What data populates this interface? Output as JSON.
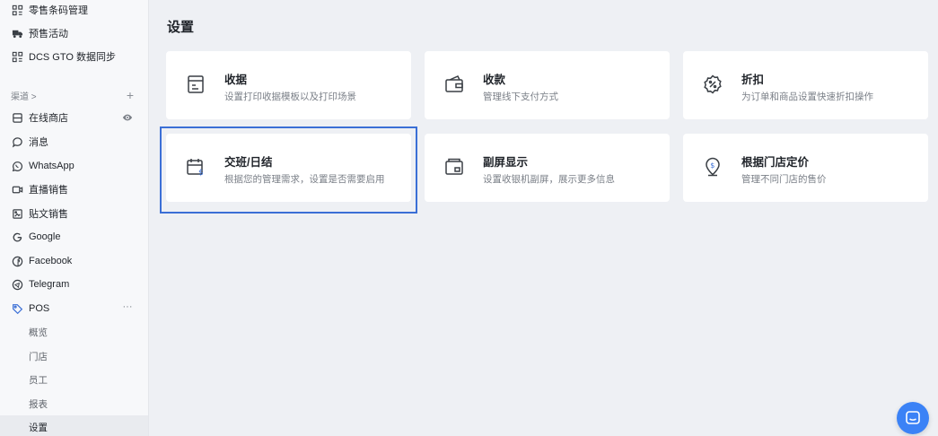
{
  "sidebar": {
    "top_items": [
      {
        "label": "零售条码管理",
        "icon": "barcode-grid-icon"
      },
      {
        "label": "预售活动",
        "icon": "truck-icon"
      },
      {
        "label": "DCS GTO 数据同步",
        "icon": "sync-grid-icon"
      }
    ],
    "channels_label": "渠道 >",
    "channels_add": "+",
    "channel_items": [
      {
        "label": "在线商店",
        "icon": "store-icon",
        "extra_icon": "eye-icon"
      },
      {
        "label": "消息",
        "icon": "message-icon"
      },
      {
        "label": "WhatsApp",
        "icon": "whatsapp-icon"
      },
      {
        "label": "直播销售",
        "icon": "live-video-icon"
      },
      {
        "label": "贴文销售",
        "icon": "post-icon"
      },
      {
        "label": "Google",
        "icon": "google-icon"
      },
      {
        "label": "Facebook",
        "icon": "facebook-icon"
      },
      {
        "label": "Telegram",
        "icon": "telegram-icon"
      },
      {
        "label": "POS",
        "icon": "pos-tag-icon",
        "extra": "···"
      }
    ],
    "pos_sub_items": [
      {
        "label": "概览"
      },
      {
        "label": "门店"
      },
      {
        "label": "员工"
      },
      {
        "label": "报表"
      },
      {
        "label": "设置",
        "active": true
      }
    ]
  },
  "page": {
    "title": "设置",
    "cards": [
      {
        "title": "收据",
        "desc": "设置打印收据模板以及打印场景",
        "icon": "receipt-icon"
      },
      {
        "title": "收款",
        "desc": "管理线下支付方式",
        "icon": "wallet-icon"
      },
      {
        "title": "折扣",
        "desc": "为订单和商品设置快速折扣操作",
        "icon": "discount-badge-icon"
      },
      {
        "title": "交班/日结",
        "desc": "根据您的管理需求，设置是否需要启用",
        "icon": "calendar-dollar-icon"
      },
      {
        "title": "副屏显示",
        "desc": "设置收银机副屏，展示更多信息",
        "icon": "second-screen-icon"
      },
      {
        "title": "根据门店定价",
        "desc": "管理不同门店的售价",
        "icon": "location-price-icon"
      }
    ]
  },
  "colors": {
    "accent": "#3b6fd6",
    "chat_button": "#3b82f6",
    "background": "#eef0f4"
  },
  "chat_icon": "chat-bubble-icon"
}
